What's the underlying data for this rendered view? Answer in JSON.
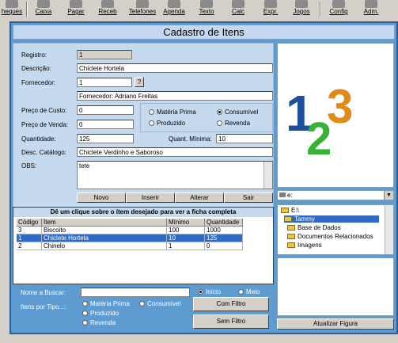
{
  "toolbar": {
    "items": [
      {
        "label": "heques",
        "icon": "checks-icon"
      },
      {
        "label": "Caixa",
        "icon": "cash-icon"
      },
      {
        "label": "Pagar",
        "icon": "pay-icon"
      },
      {
        "label": "Receb",
        "icon": "receive-icon"
      },
      {
        "label": "Telefones",
        "icon": "phone-icon"
      },
      {
        "label": "Agenda",
        "icon": "calendar-icon"
      },
      {
        "label": "Texto",
        "icon": "text-icon"
      },
      {
        "label": "Calc",
        "icon": "calculator-icon"
      },
      {
        "label": "Expr.",
        "icon": "expression-icon"
      },
      {
        "label": "Jogos",
        "icon": "games-icon"
      },
      {
        "label": "Config",
        "icon": "config-icon"
      },
      {
        "label": "Adm.",
        "icon": "admin-icon"
      }
    ]
  },
  "window": {
    "title": "Cadastro de Itens"
  },
  "form": {
    "registro_label": "Registro:",
    "registro_value": "1",
    "descricao_label": "Descrição:",
    "descricao_value": "Chiclete Hortela",
    "fornecedor_label": "Fornecedor:",
    "fornecedor_value": "1",
    "fornecedor_help": "?",
    "fornecedor_name": "Fornecedor: Adriano Freitas",
    "custo_label": "Preço de Custo:",
    "custo_value": "0",
    "venda_label": "Preço de Venda:",
    "venda_value": "0",
    "quantidade_label": "Quantidade:",
    "quantidade_value": "125",
    "quant_min_label": "Quant. Mínima:",
    "quant_min_value": "10",
    "catalogo_label": "Desc. Catálogo:",
    "catalogo_value": "Chiclete Verdinho e Saboroso",
    "obs_label": "OBS:",
    "obs_value": "tete",
    "tipo_options": [
      "Matéria Prima",
      "Consumível",
      "Produzido",
      "Revenda"
    ],
    "tipo_selected": "Consumível"
  },
  "actions": {
    "novo": "Novo",
    "inserir": "Inserir",
    "alterar": "Alterar",
    "sair": "Sair"
  },
  "grid": {
    "header": "Dê um clique sobre o ítem desejado para ver a ficha completa",
    "columns": [
      "Código",
      "Ítem",
      "Mínimo",
      "Quantidade"
    ],
    "rows": [
      [
        "3",
        "Biscoito",
        "100",
        "1000"
      ],
      [
        "1",
        "Chiclete Hortela",
        "10",
        "125"
      ],
      [
        "2",
        "Chinelo",
        "1",
        "0"
      ]
    ],
    "selected_row": 1
  },
  "search": {
    "nome_label": "Nome a Buscar:",
    "nome_value": "",
    "match_options": [
      "Início",
      "Meio"
    ],
    "match_selected": "Início",
    "tipo_label": "Itens por Tipo...:",
    "tipo_options": [
      "Matéria Prima",
      "Consumível",
      "Produzido",
      "Revenda"
    ],
    "com_filtro": "Com Filtro",
    "sem_filtro": "Sem Filtro"
  },
  "image_panel": {
    "drive": "e:",
    "folders": [
      "E:\\",
      "Tammy",
      "Base de Dados",
      "Documentos Relacionados",
      "Imagens"
    ],
    "selected_folder": "Tammy",
    "update_button": "Atualizar Figura"
  },
  "colors": {
    "window_bg": "#5e9bd1",
    "panel_bg": "#c5d9ef",
    "selection": "#316ac5",
    "digit_1": "#1e4f9e",
    "digit_2": "#38b236",
    "digit_3": "#e08a18"
  }
}
